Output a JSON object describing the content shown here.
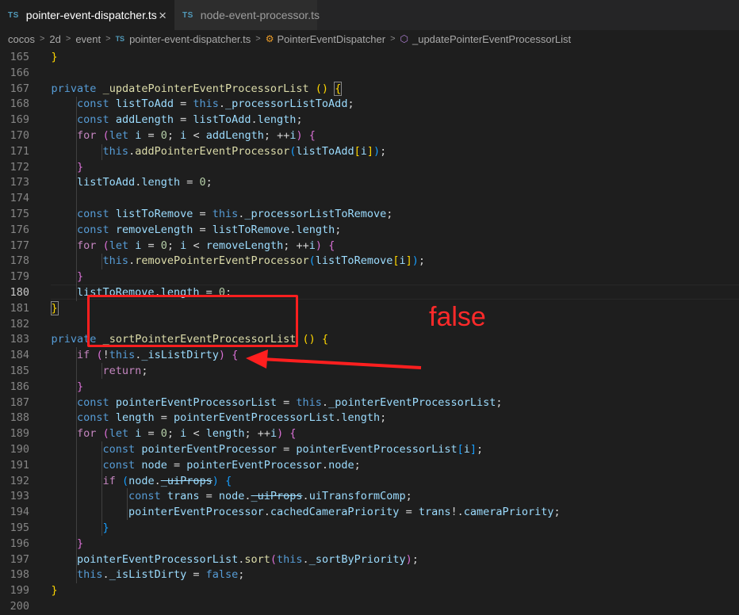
{
  "tabs": [
    {
      "badge": "TS",
      "label": "pointer-event-dispatcher.ts",
      "active": true,
      "close": "×"
    },
    {
      "badge": "TS",
      "label": "node-event-processor.ts",
      "active": false
    }
  ],
  "breadcrumb": {
    "parts": [
      "cocos",
      "2d",
      "event"
    ],
    "file_badge": "TS",
    "file": "pointer-event-dispatcher.ts",
    "class_name": "PointerEventDispatcher",
    "method_name": "_updatePointerEventProcessorList"
  },
  "editor": {
    "current_line": "180",
    "lines": [
      {
        "n": "165",
        "t": [
          [
            "p",
            "    "
          ],
          [
            "b1",
            "}"
          ]
        ]
      },
      {
        "n": "166",
        "t": []
      },
      {
        "n": "167",
        "t": [
          [
            "p",
            "    "
          ],
          [
            "k",
            "private"
          ],
          [
            "p",
            " "
          ],
          [
            "f",
            "_updatePointerEventProcessorList"
          ],
          [
            "p",
            " "
          ],
          [
            "b1",
            "()"
          ],
          [
            "p",
            " "
          ],
          [
            "b1",
            "{"
          ]
        ]
      },
      {
        "n": "168",
        "t": [
          [
            "p",
            "        "
          ],
          [
            "k",
            "const"
          ],
          [
            "p",
            " "
          ],
          [
            "v",
            "listToAdd"
          ],
          [
            "p",
            " = "
          ],
          [
            "k",
            "this"
          ],
          [
            "p",
            "."
          ],
          [
            "v",
            "_processorListToAdd"
          ],
          [
            "p",
            ";"
          ]
        ]
      },
      {
        "n": "169",
        "t": [
          [
            "p",
            "        "
          ],
          [
            "k",
            "const"
          ],
          [
            "p",
            " "
          ],
          [
            "v",
            "addLength"
          ],
          [
            "p",
            " = "
          ],
          [
            "v",
            "listToAdd"
          ],
          [
            "p",
            "."
          ],
          [
            "v",
            "length"
          ],
          [
            "p",
            ";"
          ]
        ]
      },
      {
        "n": "170",
        "t": [
          [
            "p",
            "        "
          ],
          [
            "c",
            "for"
          ],
          [
            "p",
            " "
          ],
          [
            "b2",
            "("
          ],
          [
            "k",
            "let"
          ],
          [
            "p",
            " "
          ],
          [
            "v",
            "i"
          ],
          [
            "p",
            " = "
          ],
          [
            "n",
            "0"
          ],
          [
            "p",
            "; "
          ],
          [
            "v",
            "i"
          ],
          [
            "p",
            " < "
          ],
          [
            "v",
            "addLength"
          ],
          [
            "p",
            "; ++"
          ],
          [
            "v",
            "i"
          ],
          [
            "b2",
            ")"
          ],
          [
            "p",
            " "
          ],
          [
            "b2",
            "{"
          ]
        ]
      },
      {
        "n": "171",
        "t": [
          [
            "p",
            "            "
          ],
          [
            "k",
            "this"
          ],
          [
            "p",
            "."
          ],
          [
            "f",
            "addPointerEventProcessor"
          ],
          [
            "b3",
            "("
          ],
          [
            "v",
            "listToAdd"
          ],
          [
            "b1",
            "["
          ],
          [
            "v",
            "i"
          ],
          [
            "b1",
            "]"
          ],
          [
            "b3",
            ")"
          ],
          [
            "p",
            ";"
          ]
        ]
      },
      {
        "n": "172",
        "t": [
          [
            "p",
            "        "
          ],
          [
            "b2",
            "}"
          ]
        ]
      },
      {
        "n": "173",
        "t": [
          [
            "p",
            "        "
          ],
          [
            "v",
            "listToAdd"
          ],
          [
            "p",
            "."
          ],
          [
            "v",
            "length"
          ],
          [
            "p",
            " = "
          ],
          [
            "n",
            "0"
          ],
          [
            "p",
            ";"
          ]
        ]
      },
      {
        "n": "174",
        "t": []
      },
      {
        "n": "175",
        "t": [
          [
            "p",
            "        "
          ],
          [
            "k",
            "const"
          ],
          [
            "p",
            " "
          ],
          [
            "v",
            "listToRemove"
          ],
          [
            "p",
            " = "
          ],
          [
            "k",
            "this"
          ],
          [
            "p",
            "."
          ],
          [
            "v",
            "_processorListToRemove"
          ],
          [
            "p",
            ";"
          ]
        ]
      },
      {
        "n": "176",
        "t": [
          [
            "p",
            "        "
          ],
          [
            "k",
            "const"
          ],
          [
            "p",
            " "
          ],
          [
            "v",
            "removeLength"
          ],
          [
            "p",
            " = "
          ],
          [
            "v",
            "listToRemove"
          ],
          [
            "p",
            "."
          ],
          [
            "v",
            "length"
          ],
          [
            "p",
            ";"
          ]
        ]
      },
      {
        "n": "177",
        "t": [
          [
            "p",
            "        "
          ],
          [
            "c",
            "for"
          ],
          [
            "p",
            " "
          ],
          [
            "b2",
            "("
          ],
          [
            "k",
            "let"
          ],
          [
            "p",
            " "
          ],
          [
            "v",
            "i"
          ],
          [
            "p",
            " = "
          ],
          [
            "n",
            "0"
          ],
          [
            "p",
            "; "
          ],
          [
            "v",
            "i"
          ],
          [
            "p",
            " < "
          ],
          [
            "v",
            "removeLength"
          ],
          [
            "p",
            "; ++"
          ],
          [
            "v",
            "i"
          ],
          [
            "b2",
            ")"
          ],
          [
            "p",
            " "
          ],
          [
            "b2",
            "{"
          ]
        ]
      },
      {
        "n": "178",
        "t": [
          [
            "p",
            "            "
          ],
          [
            "k",
            "this"
          ],
          [
            "p",
            "."
          ],
          [
            "f",
            "removePointerEventProcessor"
          ],
          [
            "b3",
            "("
          ],
          [
            "v",
            "listToRemove"
          ],
          [
            "b1",
            "["
          ],
          [
            "v",
            "i"
          ],
          [
            "b1",
            "]"
          ],
          [
            "b3",
            ")"
          ],
          [
            "p",
            ";"
          ]
        ]
      },
      {
        "n": "179",
        "t": [
          [
            "p",
            "        "
          ],
          [
            "b2",
            "}"
          ]
        ]
      },
      {
        "n": "180",
        "t": [
          [
            "p",
            "        "
          ],
          [
            "v",
            "listToRemove"
          ],
          [
            "p",
            "."
          ],
          [
            "v",
            "length"
          ],
          [
            "p",
            " = "
          ],
          [
            "n",
            "0"
          ],
          [
            "p",
            ";"
          ]
        ]
      },
      {
        "n": "181",
        "t": [
          [
            "p",
            "    "
          ],
          [
            "b1",
            "}"
          ]
        ]
      },
      {
        "n": "182",
        "t": []
      },
      {
        "n": "183",
        "t": [
          [
            "p",
            "    "
          ],
          [
            "k",
            "private"
          ],
          [
            "p",
            " "
          ],
          [
            "f",
            "_sortPointerEventProcessorList"
          ],
          [
            "p",
            " "
          ],
          [
            "b1",
            "()"
          ],
          [
            "p",
            " "
          ],
          [
            "b1",
            "{"
          ]
        ]
      },
      {
        "n": "184",
        "t": [
          [
            "p",
            "        "
          ],
          [
            "c",
            "if"
          ],
          [
            "p",
            " "
          ],
          [
            "b2",
            "("
          ],
          [
            "p",
            "!"
          ],
          [
            "k",
            "this"
          ],
          [
            "p",
            "."
          ],
          [
            "v",
            "_isListDirty"
          ],
          [
            "b2",
            ")"
          ],
          [
            "p",
            " "
          ],
          [
            "b2",
            "{"
          ]
        ]
      },
      {
        "n": "185",
        "t": [
          [
            "p",
            "            "
          ],
          [
            "c",
            "return"
          ],
          [
            "p",
            ";"
          ]
        ]
      },
      {
        "n": "186",
        "t": [
          [
            "p",
            "        "
          ],
          [
            "b2",
            "}"
          ]
        ]
      },
      {
        "n": "187",
        "t": [
          [
            "p",
            "        "
          ],
          [
            "k",
            "const"
          ],
          [
            "p",
            " "
          ],
          [
            "v",
            "pointerEventProcessorList"
          ],
          [
            "p",
            " = "
          ],
          [
            "k",
            "this"
          ],
          [
            "p",
            "."
          ],
          [
            "v",
            "_pointerEventProcessorList"
          ],
          [
            "p",
            ";"
          ]
        ]
      },
      {
        "n": "188",
        "t": [
          [
            "p",
            "        "
          ],
          [
            "k",
            "const"
          ],
          [
            "p",
            " "
          ],
          [
            "v",
            "length"
          ],
          [
            "p",
            " = "
          ],
          [
            "v",
            "pointerEventProcessorList"
          ],
          [
            "p",
            "."
          ],
          [
            "v",
            "length"
          ],
          [
            "p",
            ";"
          ]
        ]
      },
      {
        "n": "189",
        "t": [
          [
            "p",
            "        "
          ],
          [
            "c",
            "for"
          ],
          [
            "p",
            " "
          ],
          [
            "b2",
            "("
          ],
          [
            "k",
            "let"
          ],
          [
            "p",
            " "
          ],
          [
            "v",
            "i"
          ],
          [
            "p",
            " = "
          ],
          [
            "n",
            "0"
          ],
          [
            "p",
            "; "
          ],
          [
            "v",
            "i"
          ],
          [
            "p",
            " < "
          ],
          [
            "v",
            "length"
          ],
          [
            "p",
            "; ++"
          ],
          [
            "v",
            "i"
          ],
          [
            "b2",
            ")"
          ],
          [
            "p",
            " "
          ],
          [
            "b2",
            "{"
          ]
        ]
      },
      {
        "n": "190",
        "t": [
          [
            "p",
            "            "
          ],
          [
            "k",
            "const"
          ],
          [
            "p",
            " "
          ],
          [
            "v",
            "pointerEventProcessor"
          ],
          [
            "p",
            " = "
          ],
          [
            "v",
            "pointerEventProcessorList"
          ],
          [
            "b3",
            "["
          ],
          [
            "v",
            "i"
          ],
          [
            "b3",
            "]"
          ],
          [
            "p",
            ";"
          ]
        ]
      },
      {
        "n": "191",
        "t": [
          [
            "p",
            "            "
          ],
          [
            "k",
            "const"
          ],
          [
            "p",
            " "
          ],
          [
            "v",
            "node"
          ],
          [
            "p",
            " = "
          ],
          [
            "v",
            "pointerEventProcessor"
          ],
          [
            "p",
            "."
          ],
          [
            "v",
            "node"
          ],
          [
            "p",
            ";"
          ]
        ]
      },
      {
        "n": "192",
        "t": [
          [
            "p",
            "            "
          ],
          [
            "c",
            "if"
          ],
          [
            "p",
            " "
          ],
          [
            "b3",
            "("
          ],
          [
            "v",
            "node"
          ],
          [
            "p",
            "."
          ],
          [
            "v strike",
            "_uiProps"
          ],
          [
            "b3",
            ")"
          ],
          [
            "p",
            " "
          ],
          [
            "b3",
            "{"
          ]
        ]
      },
      {
        "n": "193",
        "t": [
          [
            "p",
            "                "
          ],
          [
            "k",
            "const"
          ],
          [
            "p",
            " "
          ],
          [
            "v",
            "trans"
          ],
          [
            "p",
            " = "
          ],
          [
            "v",
            "node"
          ],
          [
            "p",
            "."
          ],
          [
            "v strike",
            "_uiProps"
          ],
          [
            "p",
            "."
          ],
          [
            "v",
            "uiTransformComp"
          ],
          [
            "p",
            ";"
          ]
        ]
      },
      {
        "n": "194",
        "t": [
          [
            "p",
            "                "
          ],
          [
            "v",
            "pointerEventProcessor"
          ],
          [
            "p",
            "."
          ],
          [
            "v",
            "cachedCameraPriority"
          ],
          [
            "p",
            " = "
          ],
          [
            "v",
            "trans"
          ],
          [
            "p",
            "!."
          ],
          [
            "v",
            "cameraPriority"
          ],
          [
            "p",
            ";"
          ]
        ]
      },
      {
        "n": "195",
        "t": [
          [
            "p",
            "            "
          ],
          [
            "b3",
            "}"
          ]
        ]
      },
      {
        "n": "196",
        "t": [
          [
            "p",
            "        "
          ],
          [
            "b2",
            "}"
          ]
        ]
      },
      {
        "n": "197",
        "t": [
          [
            "p",
            "        "
          ],
          [
            "v",
            "pointerEventProcessorList"
          ],
          [
            "p",
            "."
          ],
          [
            "f",
            "sort"
          ],
          [
            "b2",
            "("
          ],
          [
            "k",
            "this"
          ],
          [
            "p",
            "."
          ],
          [
            "v",
            "_sortByPriority"
          ],
          [
            "b2",
            ")"
          ],
          [
            "p",
            ";"
          ]
        ]
      },
      {
        "n": "198",
        "t": [
          [
            "p",
            "        "
          ],
          [
            "k",
            "this"
          ],
          [
            "p",
            "."
          ],
          [
            "v",
            "_isListDirty"
          ],
          [
            "p",
            " = "
          ],
          [
            "k",
            "false"
          ],
          [
            "p",
            ";"
          ]
        ]
      },
      {
        "n": "199",
        "t": [
          [
            "p",
            "    "
          ],
          [
            "b1",
            "}"
          ]
        ]
      },
      {
        "n": "200",
        "t": []
      }
    ]
  },
  "annotation": {
    "label": "false",
    "color": "#ff1f1f"
  },
  "colors": {
    "background": "#1e1e1e",
    "keyword": "#569cd6",
    "control": "#c586c0",
    "function": "#dcdcaa",
    "variable": "#9cdcfe",
    "number": "#b5cea8"
  }
}
